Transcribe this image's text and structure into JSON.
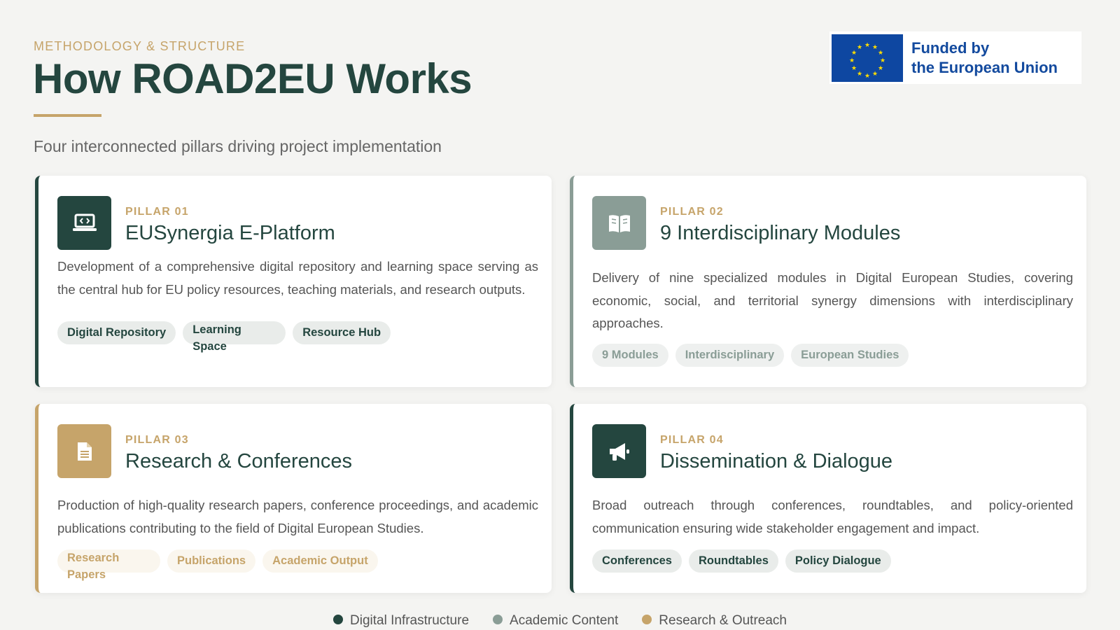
{
  "header": {
    "eyebrow": "METHODOLOGY & STRUCTURE",
    "title": "How ROAD2EU Works",
    "subtitle": "Four interconnected pillars driving project implementation"
  },
  "funding": {
    "line1": "Funded by",
    "line2": "the European Union"
  },
  "pillars": [
    {
      "num": "PILLAR 01",
      "title": "EUSynergia E-Platform",
      "icon": "laptop-code-icon",
      "desc": "Development of a comprehensive digital repository and learning space serving as the central hub for EU policy resources, teaching materials, and research outputs.",
      "tags": [
        "Digital Repository",
        "Learning Space",
        "Resource Hub"
      ]
    },
    {
      "num": "PILLAR 02",
      "title": "9 Interdisciplinary Modules",
      "icon": "book-open-icon",
      "desc": "Delivery of nine specialized modules in Digital European Studies, covering economic, social, and territorial synergy dimensions with interdisciplinary approaches.",
      "tags": [
        "9 Modules",
        "Interdisciplinary",
        "European Studies"
      ]
    },
    {
      "num": "PILLAR 03",
      "title": "Research & Conferences",
      "icon": "document-icon",
      "desc": "Production of high-quality research papers, conference proceedings, and academic publications contributing to the field of Digital European Studies.",
      "tags": [
        "Research Papers",
        "Publications",
        "Academic Output"
      ]
    },
    {
      "num": "PILLAR 04",
      "title": "Dissemination & Dialogue",
      "icon": "megaphone-icon",
      "desc": "Broad outreach through conferences, roundtables, and policy-oriented communication ensuring wide stakeholder engagement and impact.",
      "tags": [
        "Conferences",
        "Roundtables",
        "Policy Dialogue"
      ]
    }
  ],
  "legend": [
    {
      "label": "Digital Infrastructure",
      "color": "#24463f"
    },
    {
      "label": "Academic Content",
      "color": "#8a9d96"
    },
    {
      "label": "Research & Outreach",
      "color": "#c6a46a"
    }
  ],
  "colors": {
    "primary": "#24463f",
    "grey": "#8a9d96",
    "gold": "#c6a46a",
    "eu_blue": "#0e47a1",
    "eu_gold": "#ffdd00"
  }
}
